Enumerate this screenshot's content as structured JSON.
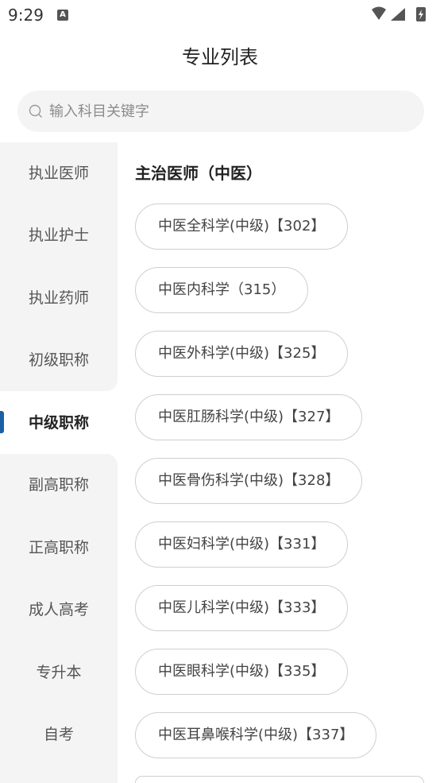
{
  "status_bar": {
    "time": "9:29",
    "notification_icon": "A"
  },
  "header": {
    "title": "专业列表"
  },
  "search": {
    "placeholder": "输入科目关键字",
    "value": ""
  },
  "sidebar": {
    "active_index": 4,
    "items": [
      {
        "label": "执业医师"
      },
      {
        "label": "执业护士"
      },
      {
        "label": "执业药师"
      },
      {
        "label": "初级职称"
      },
      {
        "label": "中级职称"
      },
      {
        "label": "副高职称"
      },
      {
        "label": "正高职称"
      },
      {
        "label": "成人高考"
      },
      {
        "label": "专升本"
      },
      {
        "label": "自考"
      }
    ]
  },
  "section": {
    "title": "主治医师（中医）",
    "subjects": [
      {
        "label": "中医全科学(中级)【302】"
      },
      {
        "label": "中医内科学（315）"
      },
      {
        "label": "中医外科学(中级)【325】"
      },
      {
        "label": "中医肛肠科学(中级)【327】"
      },
      {
        "label": "中医骨伤科学(中级)【328】"
      },
      {
        "label": "中医妇科学(中级)【331】"
      },
      {
        "label": "中医儿科学(中级)【333】"
      },
      {
        "label": "中医眼科学(中级)【335】"
      },
      {
        "label": "中医耳鼻喉科学(中级)【337】"
      }
    ]
  },
  "colors": {
    "accent": "#1b5fa6",
    "sidebar_bg": "#f4f4f4",
    "chip_border": "#cfcfcf"
  }
}
